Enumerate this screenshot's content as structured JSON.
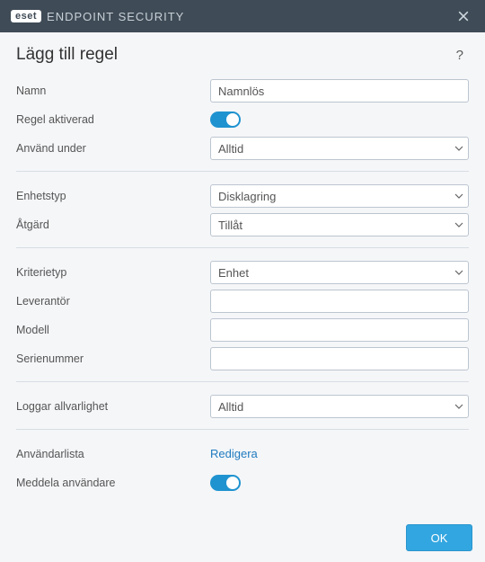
{
  "window": {
    "brand": "eset",
    "product": "ENDPOINT SECURITY"
  },
  "page": {
    "title": "Lägg till regel"
  },
  "fields": {
    "name_label": "Namn",
    "name_value": "Namnlös",
    "rule_enabled_label": "Regel aktiverad",
    "use_during_label": "Använd under",
    "use_during_value": "Alltid",
    "device_type_label": "Enhetstyp",
    "device_type_value": "Disklagring",
    "action_label": "Åtgärd",
    "action_value": "Tillåt",
    "criteria_type_label": "Kriterietyp",
    "criteria_type_value": "Enhet",
    "vendor_label": "Leverantör",
    "vendor_value": "",
    "model_label": "Modell",
    "model_value": "",
    "serial_label": "Serienummer",
    "serial_value": "",
    "log_severity_label": "Loggar allvarlighet",
    "log_severity_value": "Alltid",
    "user_list_label": "Användarlista",
    "user_list_link": "Redigera",
    "notify_user_label": "Meddela användare"
  },
  "buttons": {
    "ok": "OK"
  }
}
